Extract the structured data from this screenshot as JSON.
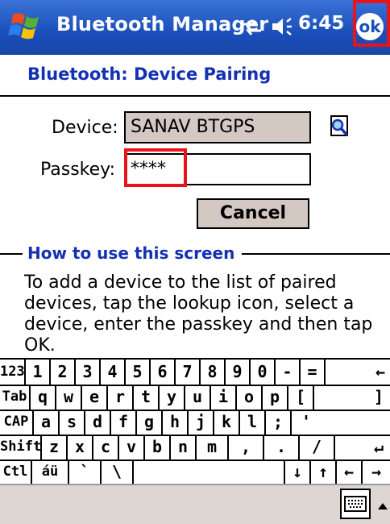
{
  "titlebar": {
    "title": "Bluetooth Manager",
    "time": "6:45",
    "ok_label": "ok"
  },
  "page": {
    "heading": "Bluetooth: Device Pairing"
  },
  "form": {
    "device_label": "Device:",
    "device_value": "SANAV BTGPS",
    "passkey_label": "Passkey:",
    "passkey_value": "****",
    "cancel_label": "Cancel"
  },
  "help": {
    "heading": "How to use this screen",
    "text": "To add a device to the list of paired devices, tap the lookup icon, select a device, enter the passkey and then tap OK."
  },
  "keyboard": {
    "rows": [
      [
        "123",
        "1",
        "2",
        "3",
        "4",
        "5",
        "6",
        "7",
        "8",
        "9",
        "0",
        "-",
        "=",
        "←"
      ],
      [
        "Tab",
        "q",
        "w",
        "e",
        "r",
        "t",
        "y",
        "u",
        "i",
        "o",
        "p",
        "[",
        "]"
      ],
      [
        "CAP",
        "a",
        "s",
        "d",
        "f",
        "g",
        "h",
        "j",
        "k",
        "l",
        ";",
        "'"
      ],
      [
        "Shift",
        "z",
        "x",
        "c",
        "v",
        "b",
        "n",
        "m",
        ",",
        ".",
        "/",
        "↵"
      ],
      [
        "Ctl",
        "áü",
        "`",
        "\\",
        "",
        "↓",
        "↑",
        "←",
        "→"
      ]
    ]
  },
  "colors": {
    "titlebar": "#1a4fb9",
    "heading": "#1431b3",
    "highlight": "#e8141b",
    "field_fill": "#d4c8c2"
  }
}
